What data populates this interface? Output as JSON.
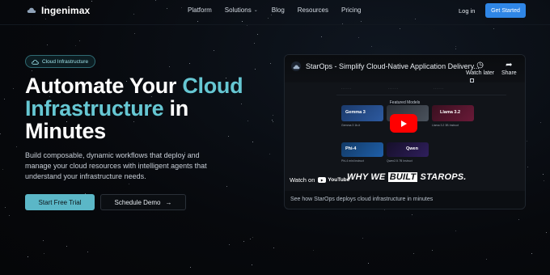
{
  "brand": {
    "name": "Ingenimax"
  },
  "nav": {
    "links": [
      "Platform",
      "Solutions",
      "Blog",
      "Resources",
      "Pricing"
    ],
    "login": "Log in",
    "cta": "Get Started"
  },
  "hero": {
    "badge": "Cloud Infrastructure",
    "headline": {
      "part1": "Automate Your ",
      "accent1": "Cloud",
      "accent2": "Infrastructure",
      "part2": " in",
      "part3": "Minutes"
    },
    "description": "Build composable, dynamic workflows that deploy and manage your cloud resources with intelligent agents that understand your infrastructure needs.",
    "primary_button": "Start Free Trial",
    "secondary_button": "Schedule Demo",
    "secondary_arrow": "→"
  },
  "video": {
    "title": "StarOps - Simplify Cloud-Native Application Delivery...",
    "watch_later": "Watch later",
    "share": "Share",
    "featured_heading": "Featured Models",
    "tiles": [
      {
        "label": "Gemma 3",
        "caption": "Gemma 3 1b-it"
      },
      {
        "label": "",
        "caption": ""
      },
      {
        "label": "Llama 3.2",
        "caption": "Llama 3.2 3B Instruct"
      },
      {
        "label": "Phi-4",
        "caption": "Phi-4 mini instruct"
      },
      {
        "label": "Qwen",
        "caption": "Qwen2.5 7B Instruct"
      }
    ],
    "watch_on": "Watch on",
    "youtube": "YouTube",
    "promo_before": "WHY WE ",
    "promo_built": "BUILT",
    "promo_after": " STAROPS.",
    "caption": "See how StarOps deploys cloud infrastructure in minutes"
  },
  "colors": {
    "accent_teal": "#66c7d3",
    "cta_blue": "#2f86e6",
    "primary_button": "#5bb7c7",
    "youtube_red": "#ff0000"
  }
}
